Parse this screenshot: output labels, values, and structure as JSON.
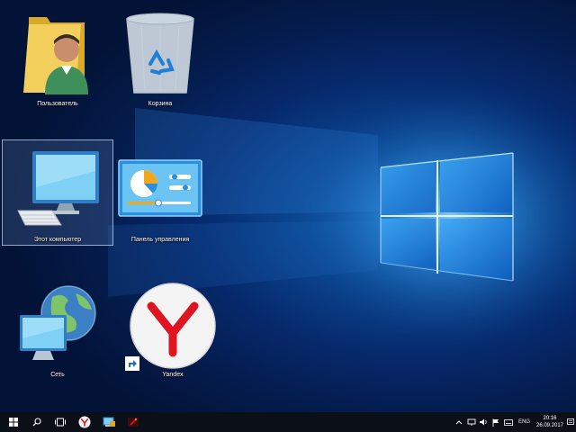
{
  "desktop": {
    "icons": [
      {
        "label": "Пользователь",
        "icon": "user-folder-icon"
      },
      {
        "label": "Корзина",
        "icon": "recycle-bin-icon"
      },
      {
        "label": "Этот компьютер",
        "icon": "this-pc-icon"
      },
      {
        "label": "Панель управления",
        "icon": "control-panel-icon"
      },
      {
        "label": "Сеть",
        "icon": "network-icon"
      },
      {
        "label": "Yandex",
        "icon": "yandex-browser-icon"
      }
    ],
    "selected_icon": "Этот компьютер"
  },
  "taskbar": {
    "buttons": [
      "start-icon",
      "search-icon",
      "task-view-icon",
      "yandex-taskbar-icon",
      "explorer-taskbar-icon",
      "app-taskbar-icon"
    ],
    "language": "ENG",
    "time": "20:16",
    "date": "26.09.2017"
  },
  "colors": {
    "wallpaper_dark": "#041b4a",
    "wallpaper_light": "#1c6fc4",
    "taskbar": "#0b0f17",
    "yandex_red": "#e0141e"
  }
}
